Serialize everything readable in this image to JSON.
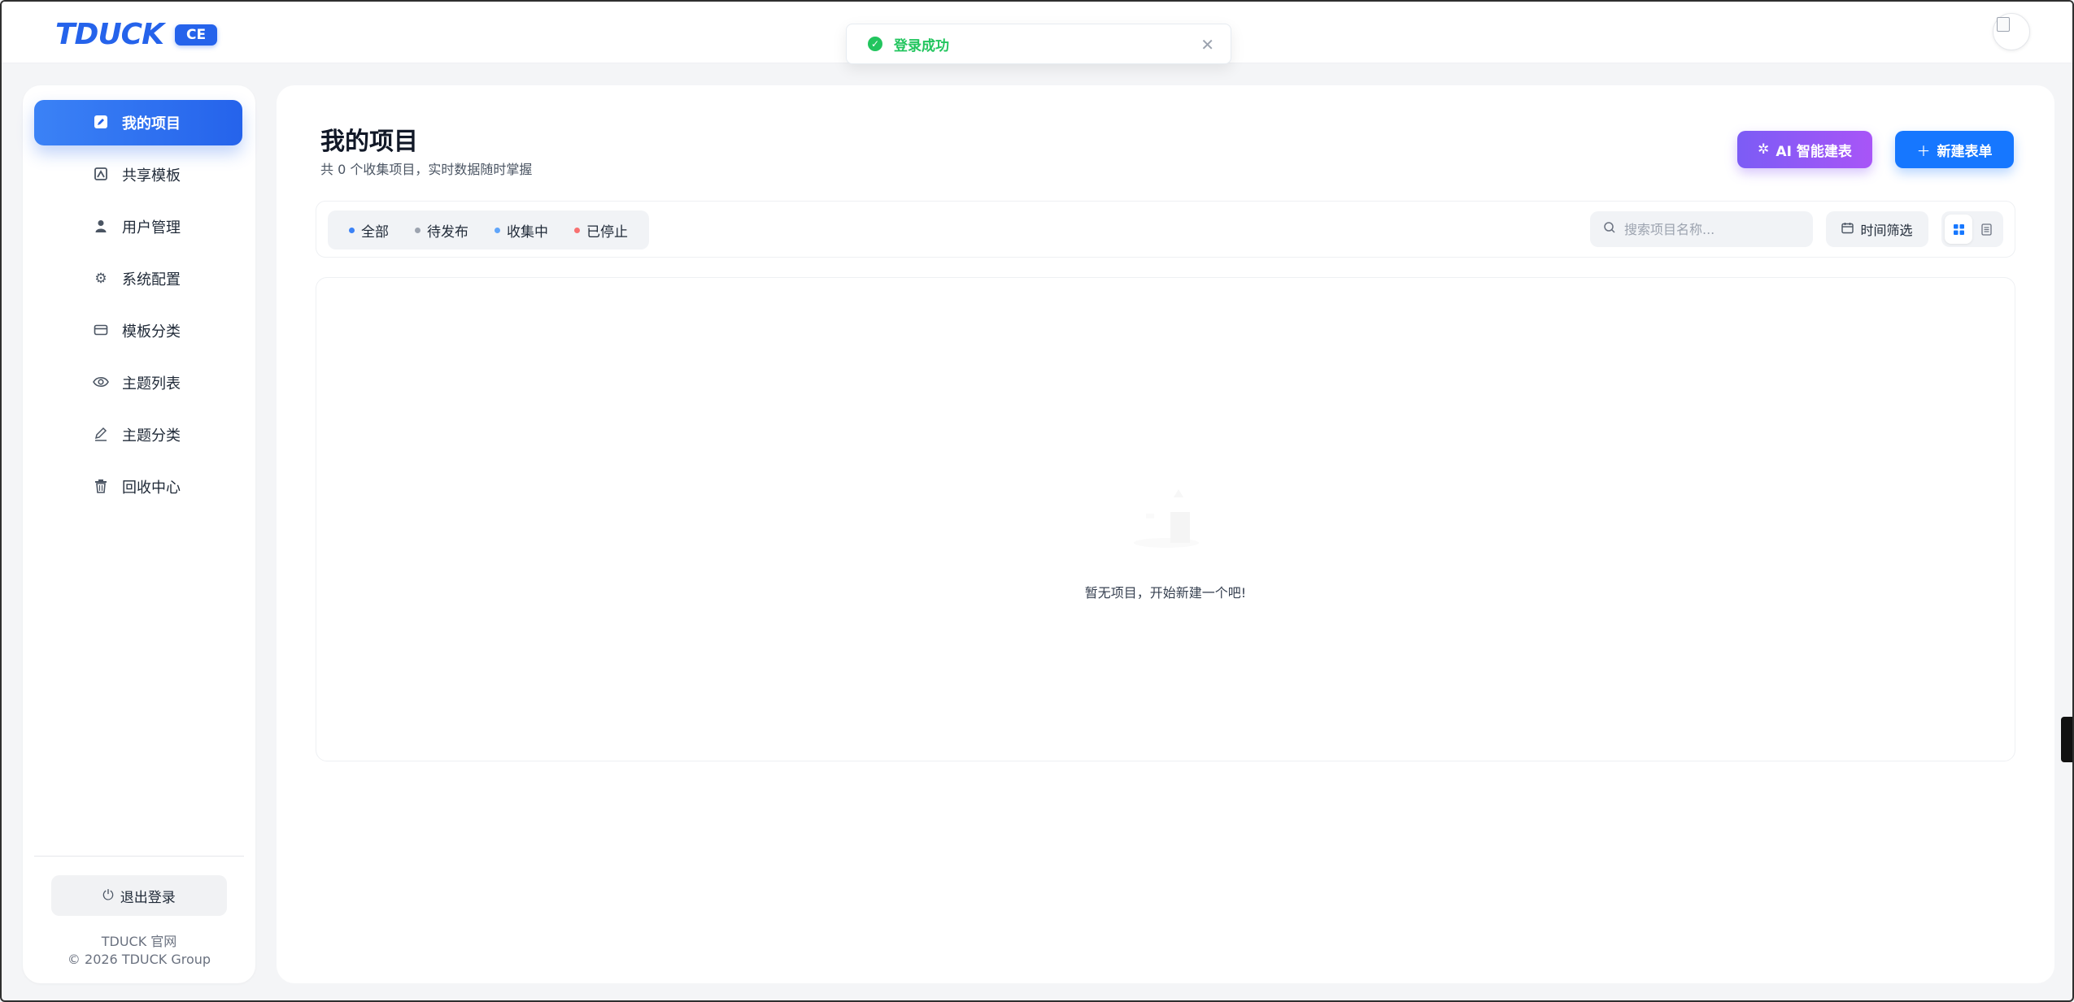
{
  "header": {
    "logo_text": "TDUCK",
    "logo_badge": "CE"
  },
  "toast": {
    "message": "登录成功",
    "status_color": "#22c55e"
  },
  "sidebar": {
    "items": [
      {
        "label": "我的项目",
        "icon": "edit-icon",
        "active": true
      },
      {
        "label": "共享模板",
        "icon": "template-icon",
        "active": false
      },
      {
        "label": "用户管理",
        "icon": "user-icon",
        "active": false
      },
      {
        "label": "系统配置",
        "icon": "gear-icon",
        "active": false
      },
      {
        "label": "模板分类",
        "icon": "card-icon",
        "active": false
      },
      {
        "label": "主题列表",
        "icon": "eye-icon",
        "active": false
      },
      {
        "label": "主题分类",
        "icon": "pen-icon",
        "active": false
      },
      {
        "label": "回收中心",
        "icon": "trash-icon",
        "active": false
      }
    ],
    "logout_label": "退出登录",
    "site_link": "TDUCK 官网",
    "copyright": "© 2026 TDUCK Group"
  },
  "main": {
    "title": "我的项目",
    "subtitle": "共 0 个收集项目，实时数据随时掌握",
    "ai_button": "AI 智能建表",
    "new_button": "新建表单",
    "filters": [
      {
        "label": "全部",
        "dot_color": "#3b82f6"
      },
      {
        "label": "待发布",
        "dot_color": "#9ca3af"
      },
      {
        "label": "收集中",
        "dot_color": "#60a5fa"
      },
      {
        "label": "已停止",
        "dot_color": "#f87171"
      }
    ],
    "search_placeholder": "搜索项目名称...",
    "time_filter": "时间筛选",
    "empty_text": "暂无项目，开始新建一个吧!"
  },
  "colors": {
    "primary": "#1677ff",
    "accent_purple": "#8b5cf6",
    "brand": "#2563eb"
  }
}
